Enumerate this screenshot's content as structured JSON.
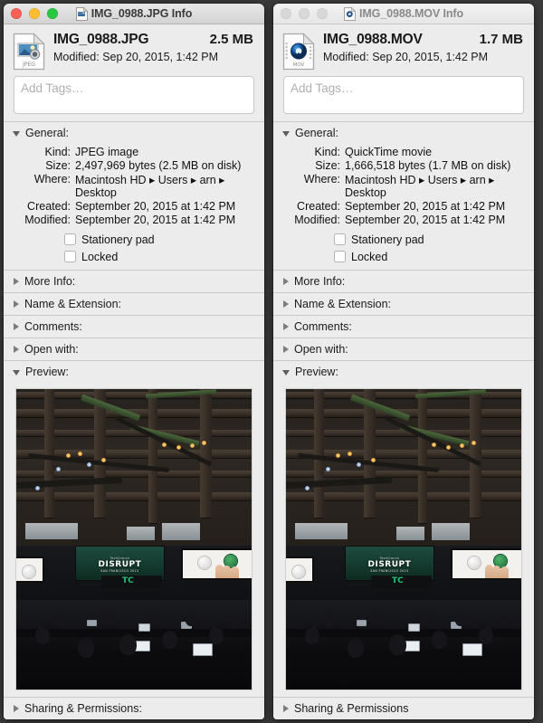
{
  "desktop": {
    "background": "#3b3b3b"
  },
  "windows": [
    {
      "id": "jpg-info",
      "active": true,
      "title": "IMG_0988.JPG Info",
      "title_icon": "jpeg-file-icon",
      "file_icon": "jpeg-file-icon",
      "file_name": "IMG_0988.JPG",
      "file_size": "2.5 MB",
      "modified_line": "Modified: Sep 20, 2015, 1:42 PM",
      "tags_placeholder": "Add Tags…",
      "general": {
        "label": "General:",
        "expanded": true,
        "fields": [
          {
            "key": "Kind:",
            "value": "JPEG image"
          },
          {
            "key": "Size:",
            "value": "2,497,969 bytes (2.5 MB on disk)"
          },
          {
            "key": "Where:",
            "value": "Macintosh HD ▸ Users ▸ arn ▸ Desktop"
          },
          {
            "key": "Created:",
            "value": "September 20, 2015 at 1:42 PM"
          },
          {
            "key": "Modified:",
            "value": "September 20, 2015 at 1:42 PM"
          }
        ],
        "checkboxes": [
          {
            "label": "Stationery pad",
            "checked": false
          },
          {
            "label": "Locked",
            "checked": false
          }
        ]
      },
      "sections": [
        {
          "label": "More Info:",
          "expanded": false
        },
        {
          "label": "Name & Extension:",
          "expanded": false
        },
        {
          "label": "Comments:",
          "expanded": false
        },
        {
          "label": "Open with:",
          "expanded": false
        },
        {
          "label": "Preview:",
          "expanded": true
        }
      ],
      "preview": {
        "description": "TechCrunch Disrupt conference hall, audience with laptops facing stage and screens",
        "screen_text": {
          "top": "TechCrunch",
          "main": "DISRUPT",
          "sub": "SAN FRANCISCO 2015"
        },
        "stage_logo": "TC"
      },
      "sharing": {
        "label": "Sharing & Permissions:",
        "expanded": false
      }
    },
    {
      "id": "mov-info",
      "active": false,
      "title": "IMG_0988.MOV Info",
      "title_icon": "quicktime-file-icon",
      "file_icon": "quicktime-file-icon",
      "file_name": "IMG_0988.MOV",
      "file_size": "1.7 MB",
      "modified_line": "Modified: Sep 20, 2015, 1:42 PM",
      "tags_placeholder": "Add Tags…",
      "general": {
        "label": "General:",
        "expanded": true,
        "fields": [
          {
            "key": "Kind:",
            "value": "QuickTime movie"
          },
          {
            "key": "Size:",
            "value": "1,666,518 bytes (1.7 MB on disk)"
          },
          {
            "key": "Where:",
            "value": "Macintosh HD ▸ Users ▸ arn ▸ Desktop"
          },
          {
            "key": "Created:",
            "value": "September 20, 2015 at 1:42 PM"
          },
          {
            "key": "Modified:",
            "value": "September 20, 2015 at 1:42 PM"
          }
        ],
        "checkboxes": [
          {
            "label": "Stationery pad",
            "checked": false
          },
          {
            "label": "Locked",
            "checked": false
          }
        ]
      },
      "sections": [
        {
          "label": "More Info:",
          "expanded": false
        },
        {
          "label": "Name & Extension:",
          "expanded": false
        },
        {
          "label": "Comments:",
          "expanded": false
        },
        {
          "label": "Open with:",
          "expanded": false
        },
        {
          "label": "Preview:",
          "expanded": true
        }
      ],
      "preview": {
        "description": "TechCrunch Disrupt conference hall, audience with laptops facing stage and screens",
        "screen_text": {
          "top": "TechCrunch",
          "main": "DISRUPT",
          "sub": "SAN FRANCISCO 2015"
        },
        "stage_logo": "TC"
      },
      "sharing": {
        "label": "Sharing & Permissions",
        "expanded": false
      }
    }
  ],
  "traffic_lights": {
    "close_label": "close",
    "minimize_label": "minimize",
    "zoom_label": "zoom",
    "close_color": "#ff5f57",
    "minimize_color": "#ffbd2e",
    "zoom_color": "#28c941",
    "inactive_color": "#d8d8d8"
  },
  "colors": {
    "window_bg": "#ececec",
    "separator": "#c9c9c9",
    "text": "#1a1a1a",
    "placeholder": "#b0b0b0"
  }
}
